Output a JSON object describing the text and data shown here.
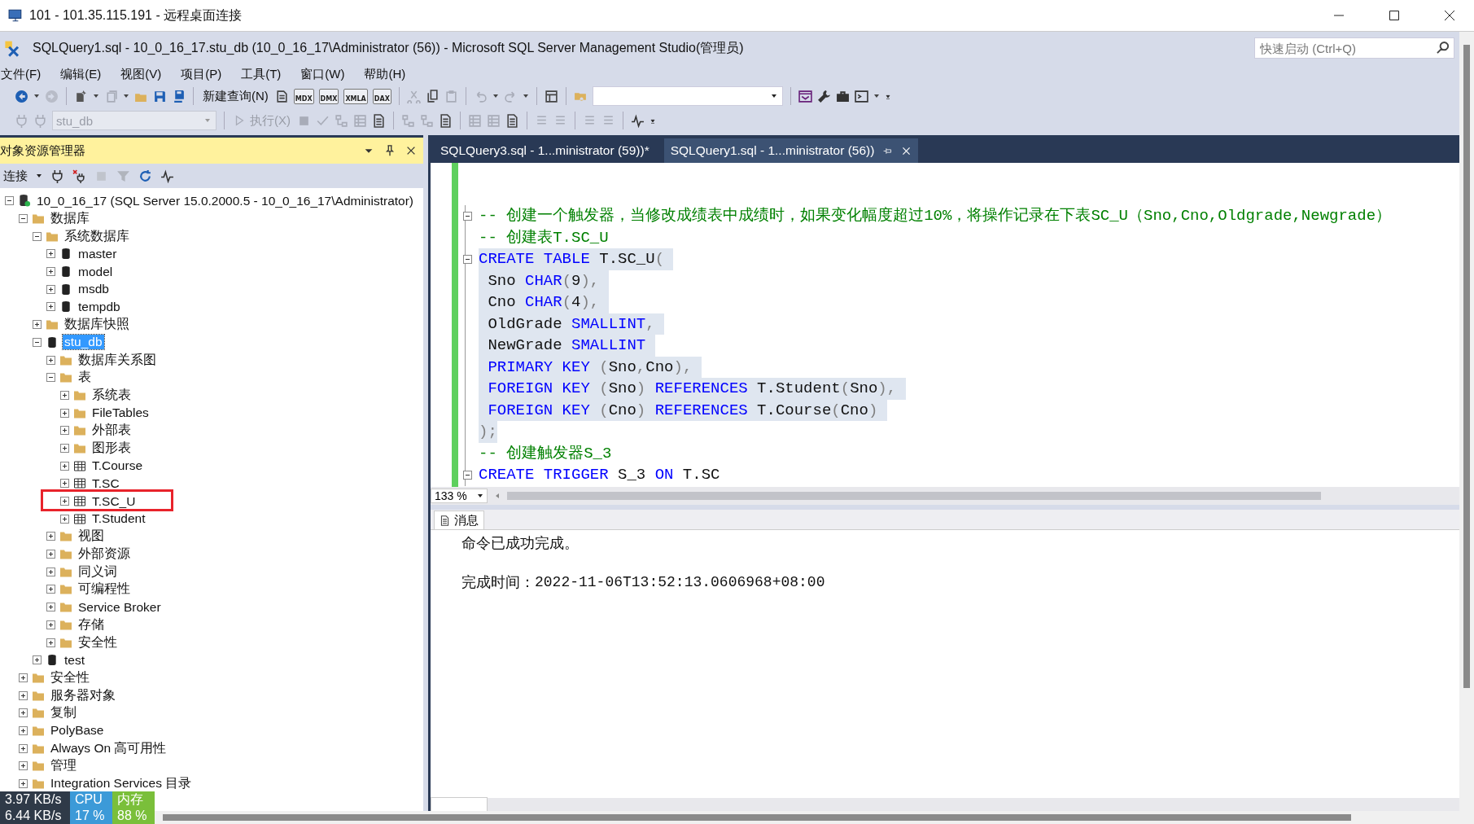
{
  "remote_window": {
    "title": "101 - 101.35.115.191 - 远程桌面连接"
  },
  "app": {
    "title": "SQLQuery1.sql - 10_0_16_17.stu_db (10_0_16_17\\Administrator (56)) - Microsoft SQL Server Management Studio(管理员)",
    "quick_launch": {
      "placeholder": "快速启动 (Ctrl+Q)"
    }
  },
  "menu": [
    "文件(F)",
    "编辑(E)",
    "视图(V)",
    "项目(P)",
    "工具(T)",
    "窗口(W)",
    "帮助(H)"
  ],
  "toolbar": {
    "new_query": "新建查询(N)",
    "query_types": [
      "MDX",
      "DMX",
      "XMLA",
      "DAX"
    ],
    "database": {
      "value": "stu_db",
      "disabled": true
    },
    "execute": {
      "label": "执行(X)",
      "disabled": true
    }
  },
  "object_explorer": {
    "title": "对象资源管理器",
    "connect": "连接",
    "tree": [
      {
        "label": "10_0_16_17 (SQL Server 15.0.2000.5 - 10_0_16_17\\Administrator)",
        "kind": "server",
        "expanded": true,
        "selected": false,
        "children": [
          {
            "label": "数据库",
            "kind": "folder",
            "expanded": true,
            "selected": false,
            "children": [
              {
                "label": "系统数据库",
                "kind": "folder",
                "expanded": true,
                "selected": false,
                "children": [
                  {
                    "label": "master",
                    "kind": "database",
                    "expanded": false,
                    "selected": false
                  },
                  {
                    "label": "model",
                    "kind": "database",
                    "expanded": false,
                    "selected": false
                  },
                  {
                    "label": "msdb",
                    "kind": "database",
                    "expanded": false,
                    "selected": false
                  },
                  {
                    "label": "tempdb",
                    "kind": "database",
                    "expanded": false,
                    "selected": false
                  }
                ]
              },
              {
                "label": "数据库快照",
                "kind": "folder",
                "expanded": false,
                "selected": false
              },
              {
                "label": "stu_db",
                "kind": "database",
                "expanded": true,
                "selected": true,
                "children": [
                  {
                    "label": "数据库关系图",
                    "kind": "folder",
                    "expanded": false,
                    "selected": false
                  },
                  {
                    "label": "表",
                    "kind": "folder",
                    "expanded": true,
                    "selected": false,
                    "children": [
                      {
                        "label": "系统表",
                        "kind": "folder",
                        "expanded": false,
                        "selected": false
                      },
                      {
                        "label": "FileTables",
                        "kind": "folder",
                        "expanded": false,
                        "selected": false
                      },
                      {
                        "label": "外部表",
                        "kind": "folder",
                        "expanded": false,
                        "selected": false
                      },
                      {
                        "label": "图形表",
                        "kind": "folder",
                        "expanded": false,
                        "selected": false
                      },
                      {
                        "label": "T.Course",
                        "kind": "table",
                        "expanded": false,
                        "selected": false
                      },
                      {
                        "label": "T.SC",
                        "kind": "table",
                        "expanded": false,
                        "selected": false
                      },
                      {
                        "label": "T.SC_U",
                        "kind": "table",
                        "expanded": false,
                        "selected": false,
                        "annotated": true
                      },
                      {
                        "label": "T.Student",
                        "kind": "table",
                        "expanded": false,
                        "selected": false
                      }
                    ]
                  },
                  {
                    "label": "视图",
                    "kind": "folder",
                    "expanded": false,
                    "selected": false
                  },
                  {
                    "label": "外部资源",
                    "kind": "folder",
                    "expanded": false,
                    "selected": false
                  },
                  {
                    "label": "同义词",
                    "kind": "folder",
                    "expanded": false,
                    "selected": false
                  },
                  {
                    "label": "可编程性",
                    "kind": "folder",
                    "expanded": false,
                    "selected": false
                  },
                  {
                    "label": "Service Broker",
                    "kind": "folder",
                    "expanded": false,
                    "selected": false
                  },
                  {
                    "label": "存储",
                    "kind": "folder",
                    "expanded": false,
                    "selected": false
                  },
                  {
                    "label": "安全性",
                    "kind": "folder",
                    "expanded": false,
                    "selected": false
                  }
                ]
              },
              {
                "label": "test",
                "kind": "database",
                "expanded": false,
                "selected": false
              }
            ]
          },
          {
            "label": "安全性",
            "kind": "folder",
            "expanded": false,
            "selected": false
          },
          {
            "label": "服务器对象",
            "kind": "folder",
            "expanded": false,
            "selected": false
          },
          {
            "label": "复制",
            "kind": "folder",
            "expanded": false,
            "selected": false
          },
          {
            "label": "PolyBase",
            "kind": "folder",
            "expanded": false,
            "selected": false
          },
          {
            "label": "Always On 高可用性",
            "kind": "folder",
            "expanded": false,
            "selected": false
          },
          {
            "label": "管理",
            "kind": "folder",
            "expanded": false,
            "selected": false
          },
          {
            "label": "Integration Services 目录",
            "kind": "folder",
            "expanded": false,
            "selected": false
          }
        ]
      }
    ]
  },
  "editor": {
    "tabs": [
      {
        "label": "SQLQuery3.sql - 1...ministrator (59))*",
        "selected": false
      },
      {
        "label": "SQLQuery1.sql - 1...ministrator (56))",
        "selected": true
      }
    ],
    "lines": [
      {
        "fold": true,
        "selected": false,
        "segments": [
          {
            "kind": "cm",
            "t": "-- 创建一个触发器，当修改成绩表中成绩时，如果变化幅度超过10%，将操作记录在下表SC_U（Sno,Cno,Oldgrade,Newgrade）"
          }
        ]
      },
      {
        "fold": false,
        "selected": false,
        "segments": [
          {
            "kind": "cm",
            "t": "-- 创建表T.SC_U"
          }
        ]
      },
      {
        "fold": true,
        "selected": true,
        "segments": [
          {
            "kind": "kw",
            "t": "CREATE TABLE "
          },
          {
            "kind": "id",
            "t": "T.SC_U"
          },
          {
            "kind": "op",
            "t": "( "
          }
        ]
      },
      {
        "fold": false,
        "selected": true,
        "segments": [
          {
            "kind": "id",
            "t": " Sno "
          },
          {
            "kind": "kw",
            "t": "CHAR"
          },
          {
            "kind": "op",
            "t": "("
          },
          {
            "kind": "id",
            "t": "9"
          },
          {
            "kind": "op",
            "t": "), "
          }
        ]
      },
      {
        "fold": false,
        "selected": true,
        "segments": [
          {
            "kind": "id",
            "t": " Cno "
          },
          {
            "kind": "kw",
            "t": "CHAR"
          },
          {
            "kind": "op",
            "t": "("
          },
          {
            "kind": "id",
            "t": "4"
          },
          {
            "kind": "op",
            "t": "), "
          }
        ]
      },
      {
        "fold": false,
        "selected": true,
        "segments": [
          {
            "kind": "id",
            "t": " OldGrade "
          },
          {
            "kind": "kw",
            "t": "SMALLINT"
          },
          {
            "kind": "op",
            "t": ", "
          }
        ]
      },
      {
        "fold": false,
        "selected": true,
        "segments": [
          {
            "kind": "id",
            "t": " NewGrade "
          },
          {
            "kind": "kw",
            "t": "SMALLINT "
          }
        ]
      },
      {
        "fold": false,
        "selected": true,
        "segments": [
          {
            "kind": "kw",
            "t": " PRIMARY KEY "
          },
          {
            "kind": "op",
            "t": "("
          },
          {
            "kind": "id",
            "t": "Sno"
          },
          {
            "kind": "op",
            "t": ","
          },
          {
            "kind": "id",
            "t": "Cno"
          },
          {
            "kind": "op",
            "t": "), "
          }
        ]
      },
      {
        "fold": false,
        "selected": true,
        "segments": [
          {
            "kind": "kw",
            "t": " FOREIGN KEY "
          },
          {
            "kind": "op",
            "t": "("
          },
          {
            "kind": "id",
            "t": "Sno"
          },
          {
            "kind": "op",
            "t": ") "
          },
          {
            "kind": "kw",
            "t": "REFERENCES "
          },
          {
            "kind": "id",
            "t": "T.Student"
          },
          {
            "kind": "op",
            "t": "("
          },
          {
            "kind": "id",
            "t": "Sno"
          },
          {
            "kind": "op",
            "t": "), "
          }
        ]
      },
      {
        "fold": false,
        "selected": true,
        "segments": [
          {
            "kind": "kw",
            "t": " FOREIGN KEY "
          },
          {
            "kind": "op",
            "t": "("
          },
          {
            "kind": "id",
            "t": "Cno"
          },
          {
            "kind": "op",
            "t": ") "
          },
          {
            "kind": "kw",
            "t": "REFERENCES "
          },
          {
            "kind": "id",
            "t": "T.Course"
          },
          {
            "kind": "op",
            "t": "("
          },
          {
            "kind": "id",
            "t": "Cno"
          },
          {
            "kind": "op",
            "t": ") "
          }
        ]
      },
      {
        "fold": false,
        "selected": true,
        "segments": [
          {
            "kind": "op",
            "t": ");"
          }
        ]
      },
      {
        "fold": false,
        "selected": false,
        "segments": [
          {
            "kind": "cm",
            "t": "-- 创建触发器S_3"
          }
        ]
      },
      {
        "fold": true,
        "selected": false,
        "segments": [
          {
            "kind": "kw",
            "t": "CREATE TRIGGER "
          },
          {
            "kind": "id",
            "t": "S_3 "
          },
          {
            "kind": "kw",
            "t": "ON "
          },
          {
            "kind": "id",
            "t": "T.SC"
          }
        ]
      }
    ],
    "zoom": "133 %"
  },
  "messages": {
    "tab": "消息",
    "result": "命令已成功完成。",
    "finished_label": "完成时间：",
    "finished_time": "2022-11-06T13:52:13.0606968+08:00"
  },
  "net_monitor": {
    "upload": "3.97 KB/s",
    "download": "6.44 KB/s",
    "cpu_label": "CPU",
    "cpu": "17 %",
    "mem_label": "内存",
    "mem": "88 %"
  }
}
